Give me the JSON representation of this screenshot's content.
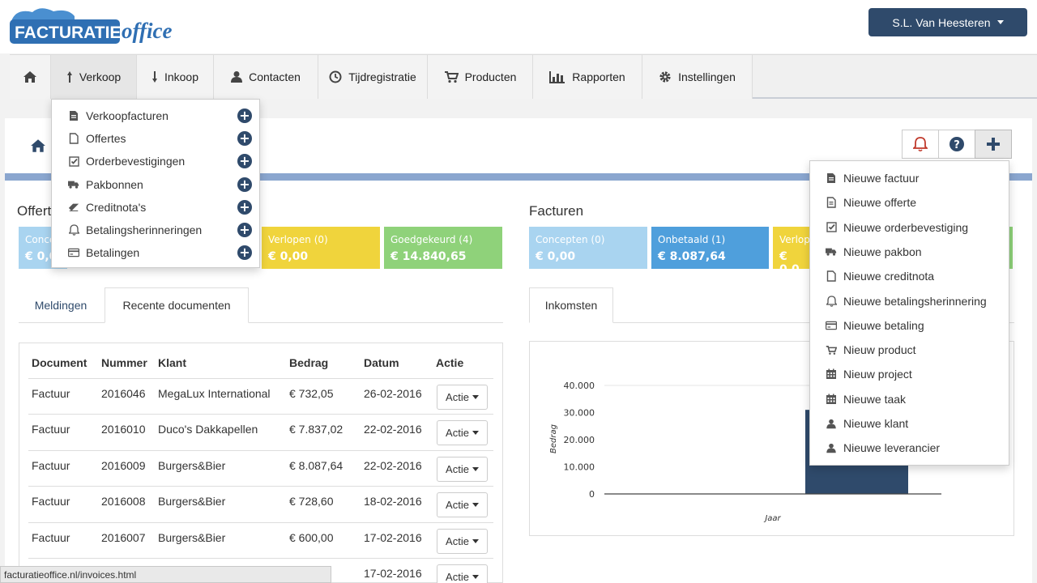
{
  "app": {
    "logo_left": "FACTURATIE",
    "logo_right": "office",
    "user_name": "S.L. Van Heesteren"
  },
  "nav": {
    "items": [
      {
        "label": "",
        "icon": "home-icon"
      },
      {
        "label": "Verkoop",
        "icon": "arrow-up-icon"
      },
      {
        "label": "Inkoop",
        "icon": "arrow-down-icon"
      },
      {
        "label": "Contacten",
        "icon": "user-icon"
      },
      {
        "label": "Tijdregistratie",
        "icon": "clock-icon"
      },
      {
        "label": "Producten",
        "icon": "cart-icon"
      },
      {
        "label": "Rapporten",
        "icon": "bar-chart-icon"
      },
      {
        "label": "Instellingen",
        "icon": "gear-icon"
      }
    ]
  },
  "verkoop_menu": {
    "items": [
      {
        "label": "Verkoopfacturen",
        "icon": "file-icon"
      },
      {
        "label": "Offertes",
        "icon": "file-outline-icon"
      },
      {
        "label": "Orderbevestigingen",
        "icon": "check-square-icon"
      },
      {
        "label": "Pakbonnen",
        "icon": "truck-icon"
      },
      {
        "label": "Creditnota's",
        "icon": "eraser-icon"
      },
      {
        "label": "Betalingsherinneringen",
        "icon": "bell-icon"
      },
      {
        "label": "Betalingen",
        "icon": "credit-card-icon"
      }
    ]
  },
  "new_menu": {
    "items": [
      {
        "label": "Nieuwe factuur",
        "icon": "file-icon"
      },
      {
        "label": "Nieuwe offerte",
        "icon": "file-text-icon"
      },
      {
        "label": "Nieuwe orderbevestiging",
        "icon": "check-square-icon"
      },
      {
        "label": "Nieuwe pakbon",
        "icon": "truck-icon"
      },
      {
        "label": "Nieuwe creditnota",
        "icon": "file-outline-icon"
      },
      {
        "label": "Nieuwe betalingsherinnering",
        "icon": "bell-icon"
      },
      {
        "label": "Nieuwe betaling",
        "icon": "credit-card-icon"
      },
      {
        "label": "Nieuw product",
        "icon": "cart-icon"
      },
      {
        "label": "Nieuw project",
        "icon": "calendar-icon"
      },
      {
        "label": "Nieuwe taak",
        "icon": "calendar-icon"
      },
      {
        "label": "Nieuwe klant",
        "icon": "user-icon"
      },
      {
        "label": "Nieuwe leverancier",
        "icon": "user-icon"
      }
    ]
  },
  "offertes": {
    "title": "Offert",
    "tiles": [
      {
        "label": "Concep",
        "value": "€ 0,0",
        "color": "#a9d4f0"
      },
      {
        "label": "Verlopen (0)",
        "value": "€ 0,00",
        "color": "#f0d43c"
      },
      {
        "label": "Goedgekeurd (4)",
        "value": "€ 14.840,65",
        "color": "#8fd27a"
      }
    ]
  },
  "facturen": {
    "title": "Facturen",
    "tiles": [
      {
        "label": "Concepten (0)",
        "value": "€ 0,00",
        "color": "#a9d4f0"
      },
      {
        "label": "Onbetaald (1)",
        "value": "€ 8.087,64",
        "color": "#4f9fdc"
      },
      {
        "label": "Verlop",
        "value": "€ 0,0",
        "color": "#f0d43c"
      },
      {
        "label": "",
        "value": "",
        "color": "#8fd27a"
      }
    ]
  },
  "left_tabs": [
    {
      "label": "Meldingen"
    },
    {
      "label": "Recente documenten"
    }
  ],
  "right_tabs": [
    {
      "label": "Inkomsten"
    }
  ],
  "table": {
    "headers": [
      "Document",
      "Nummer",
      "Klant",
      "Bedrag",
      "Datum",
      "Actie"
    ],
    "action_label": "Actie",
    "rows": [
      {
        "doc": "Factuur",
        "num": "2016046",
        "klant": "MegaLux International",
        "bedrag": "€ 732,05",
        "datum": "26-02-2016"
      },
      {
        "doc": "Factuur",
        "num": "2016010",
        "klant": "Duco's Dakkapellen",
        "bedrag": "€ 7.837,02",
        "datum": "22-02-2016"
      },
      {
        "doc": "Factuur",
        "num": "2016009",
        "klant": "Burgers&Bier",
        "bedrag": "€ 8.087,64",
        "datum": "22-02-2016"
      },
      {
        "doc": "Factuur",
        "num": "2016008",
        "klant": "Burgers&Bier",
        "bedrag": "€ 728,60",
        "datum": "18-02-2016"
      },
      {
        "doc": "Factuur",
        "num": "2016007",
        "klant": "Burgers&Bier",
        "bedrag": "€ 600,00",
        "datum": "17-02-2016"
      },
      {
        "doc": "",
        "num": "",
        "klant": "",
        "bedrag": "",
        "datum": "17-02-2016"
      }
    ]
  },
  "chart_data": {
    "type": "bar",
    "ylabel": "Bedrag",
    "xlabel": "Jaar",
    "ylim": [
      0,
      40000
    ],
    "y_ticks": [
      "0",
      "10.000",
      "20.000",
      "30.000",
      "40.000"
    ],
    "tick_values": [
      0,
      10000,
      20000,
      30000,
      40000
    ],
    "values": [
      31000
    ],
    "bar_color": "#2f4a6b"
  },
  "status_url": "facturatieoffice.nl/invoices.html"
}
